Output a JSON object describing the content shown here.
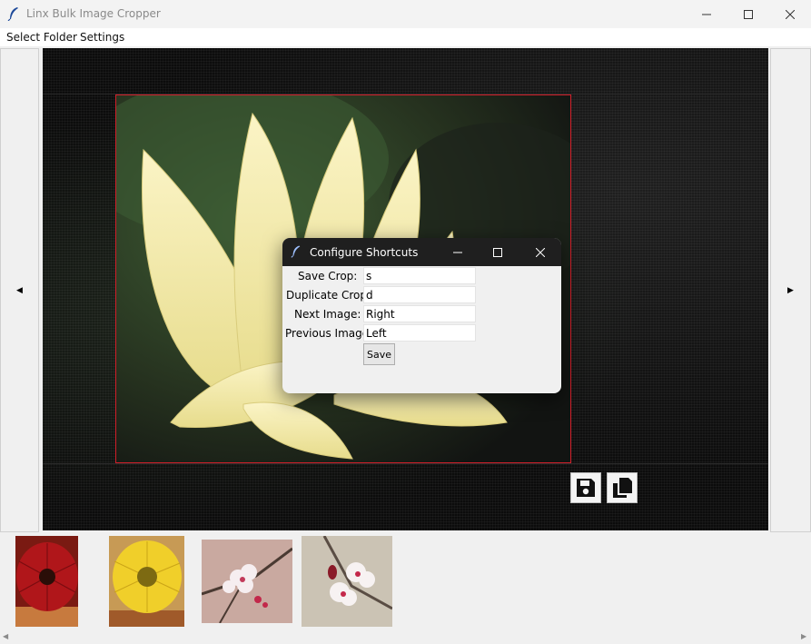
{
  "window": {
    "title": "Linx Bulk Image Cropper",
    "controls": [
      "minimize",
      "maximize",
      "close"
    ]
  },
  "menu": {
    "items": [
      "Select Folder",
      "Settings"
    ]
  },
  "navigation": {
    "prev_glyph": "◀",
    "next_glyph": "▶"
  },
  "canvas": {
    "crop_border_color": "#d21f2a",
    "actions": [
      "save-icon",
      "duplicate-icon"
    ]
  },
  "dialog": {
    "title": "Configure Shortcuts",
    "fields": [
      {
        "label": "Save Crop:",
        "value": "s"
      },
      {
        "label": "Duplicate Crop:",
        "value": "d"
      },
      {
        "label": "Next Image:",
        "value": "Right"
      },
      {
        "label": "Previous Image:",
        "value": "Left"
      }
    ],
    "save_label": "Save"
  },
  "thumbnails": [
    {
      "subject": "red-gerbera"
    },
    {
      "subject": "yellow-gerbera"
    },
    {
      "subject": "cherry-blossom"
    },
    {
      "subject": "cherry-blossom-close"
    }
  ],
  "scrollbar": {
    "left_glyph": "◀",
    "right_glyph": "▶"
  }
}
